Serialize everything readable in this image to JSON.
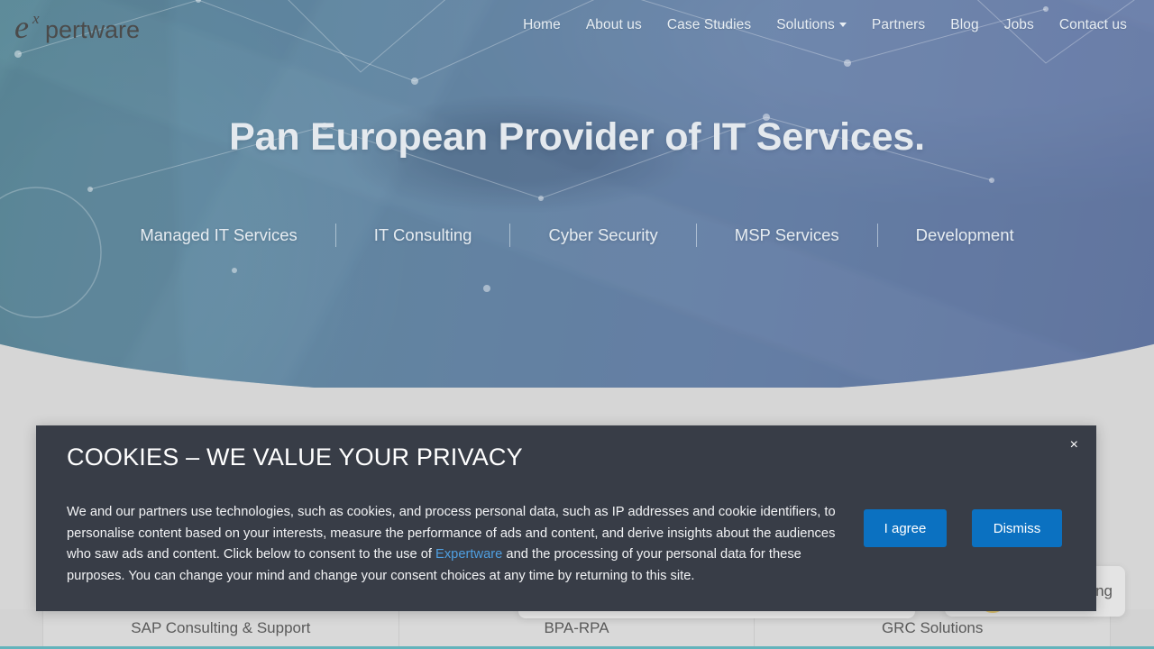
{
  "brand": {
    "name": "expertware",
    "logo_mark": "e",
    "logo_superscript": "x",
    "logo_word": "pertware"
  },
  "nav": {
    "items": [
      {
        "label": "Home",
        "has_caret": false
      },
      {
        "label": "About us",
        "has_caret": false
      },
      {
        "label": "Case Studies",
        "has_caret": false
      },
      {
        "label": "Solutions",
        "has_caret": true
      },
      {
        "label": "Partners",
        "has_caret": false
      },
      {
        "label": "Blog",
        "has_caret": false
      },
      {
        "label": "Jobs",
        "has_caret": false
      },
      {
        "label": "Contact us",
        "has_caret": false
      }
    ]
  },
  "hero": {
    "headline": "Pan European Provider of IT Services.",
    "service_links": [
      "Managed IT Services",
      "IT Consulting",
      "Cyber Security",
      "MSP Services",
      "Development"
    ]
  },
  "cards": {
    "items": [
      "SAP Consulting & Support",
      "BPA-RPA",
      "GRC Solutions"
    ],
    "peek_label": "ting"
  },
  "cookie_banner": {
    "title": "COOKIES – WE VALUE YOUR PRIVACY",
    "close_label": "×",
    "body_part1": "We and our partners use technologies, such as cookies, and process personal data, such as IP addresses and cookie identifiers, to personalise content based on your interests, measure the performance of ads and content, and derive insights about the audiences who saw ads and content. Click below to consent to the use of ",
    "body_link": "Expertware",
    "body_part2": " and the processing of your personal data for these purposes. You can change your mind and change your consent choices at any time by returning to this site.",
    "agree_label": "I agree",
    "dismiss_label": "Dismiss",
    "accent_color": "#0b71c1",
    "background_color": "#383d47",
    "link_color": "#4f9fe0"
  }
}
